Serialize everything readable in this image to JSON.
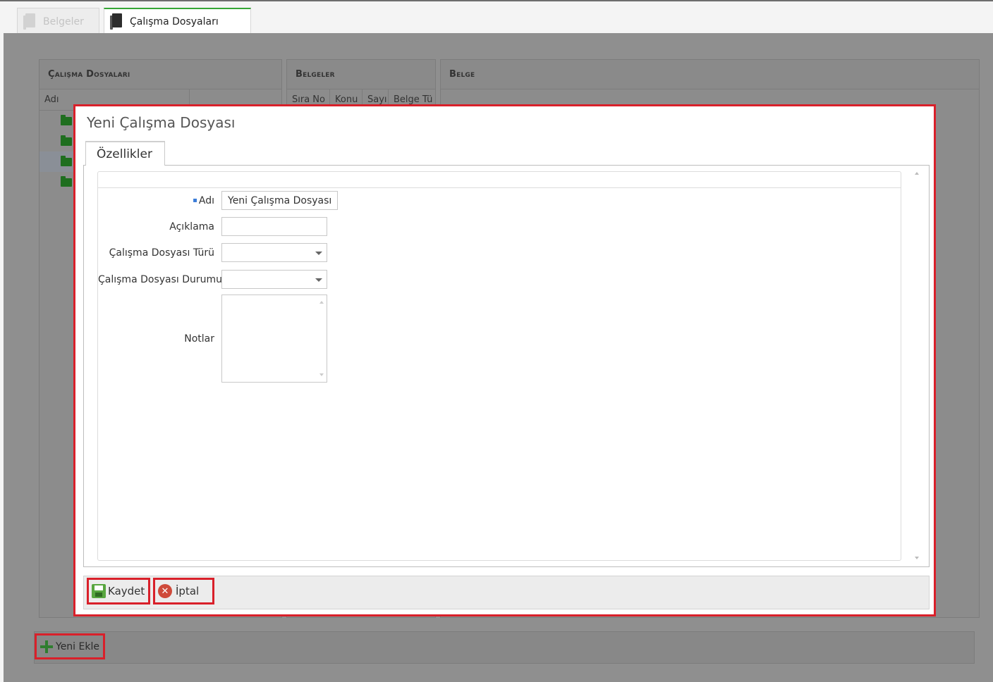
{
  "tabs": [
    {
      "label": "Belgeler",
      "active": false
    },
    {
      "label": "Çalışma Dosyaları",
      "active": true
    }
  ],
  "panels": {
    "work_files": {
      "title": "Çalışma Dosyaları",
      "columns": [
        "Adı",
        ""
      ]
    },
    "documents": {
      "title": "Belgeler",
      "columns": [
        "Sıra No",
        "Konu",
        "Sayı",
        "Belge Tü"
      ]
    },
    "document": {
      "title": "Belge"
    }
  },
  "toolbar": {
    "add_label": "Yeni Ekle"
  },
  "dialog": {
    "title": "Yeni Çalışma Dosyası",
    "tab_label": "Özellikler",
    "fields": {
      "name_label": "Adı",
      "name_value": "Yeni Çalışma Dosyası",
      "description_label": "Açıklama",
      "description_value": "",
      "type_label": "Çalışma Dosyası Türü",
      "type_value": "",
      "status_label": "Çalışma Dosyası Durumu",
      "status_value": "",
      "notes_label": "Notlar",
      "notes_value": ""
    },
    "save_label": "Kaydet",
    "cancel_label": "İptal"
  },
  "colors": {
    "accent_green": "#35a535",
    "highlight_red": "#d9202a"
  }
}
